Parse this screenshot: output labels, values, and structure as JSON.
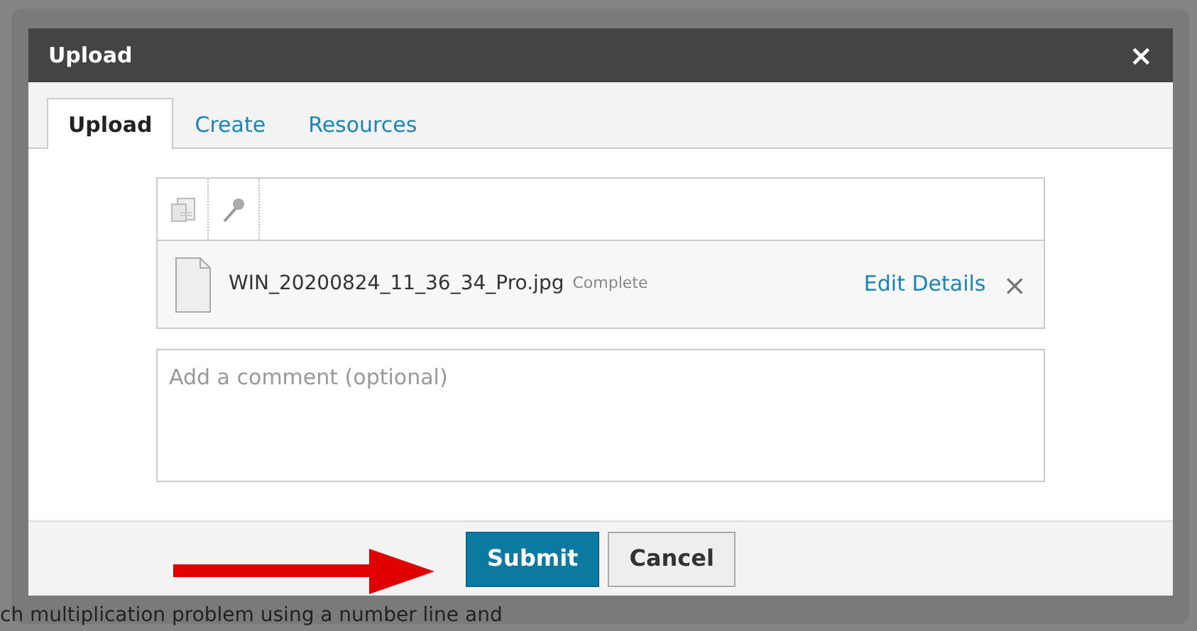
{
  "dialog": {
    "title": "Upload",
    "close": "×"
  },
  "tabs": [
    {
      "label": "Upload",
      "selected": true
    },
    {
      "label": "Create",
      "selected": false
    },
    {
      "label": "Resources",
      "selected": false
    }
  ],
  "files": [
    {
      "name": "WIN_20200824_11_36_34_Pro.jpg",
      "status": "Complete",
      "action": "Edit Details",
      "remove": "×"
    }
  ],
  "comment": {
    "placeholder": "Add a comment (optional)"
  },
  "buttons": [
    {
      "label": "Submit",
      "kind": "primary"
    },
    {
      "label": "Cancel",
      "kind": "secondary"
    }
  ],
  "background_text": "ch multiplication problem using a number line and"
}
